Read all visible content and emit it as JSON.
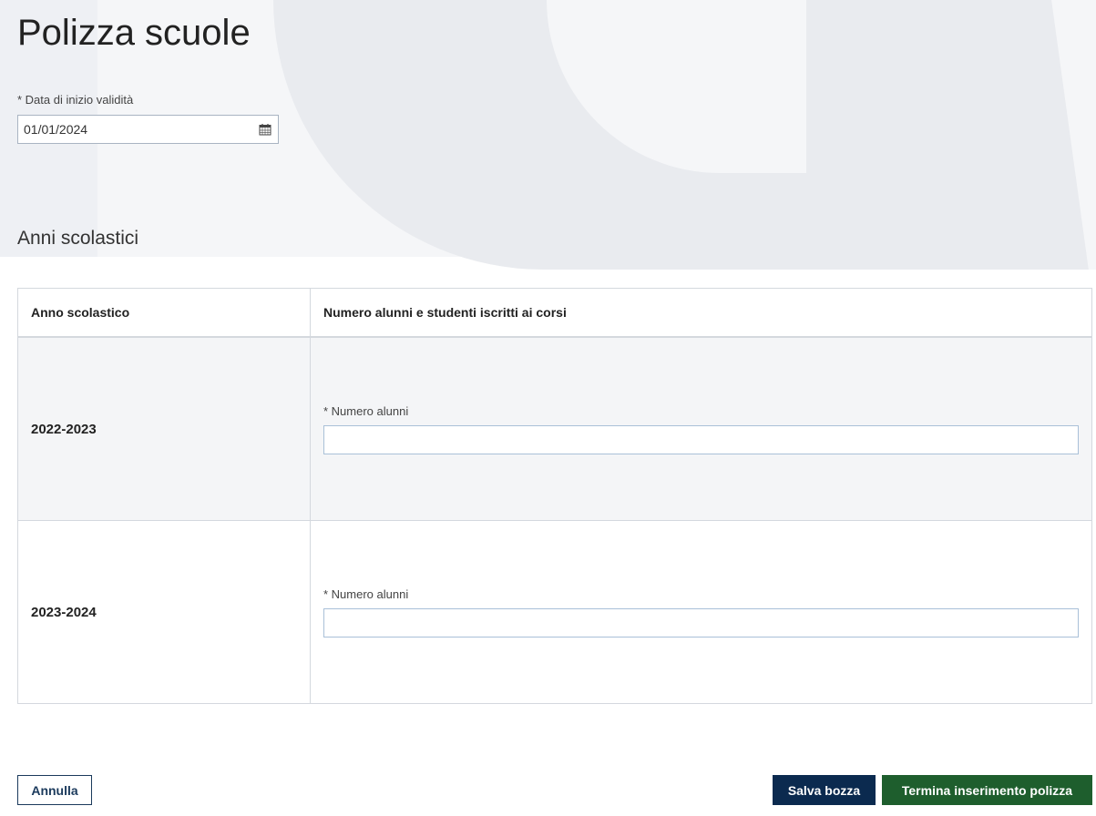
{
  "page": {
    "title": "Polizza scuole"
  },
  "validity": {
    "label": "* Data di inizio validità",
    "value": "01/01/2024",
    "icon": "calendar-icon"
  },
  "section": {
    "title": "Anni scolastici"
  },
  "table": {
    "headers": [
      "Anno scolastico",
      "Numero alunni e studenti iscritti ai corsi"
    ],
    "rows": [
      {
        "year": "2022-2023",
        "field_label": "* Numero alunni",
        "value": ""
      },
      {
        "year": "2023-2024",
        "field_label": "* Numero alunni",
        "value": ""
      }
    ]
  },
  "actions": {
    "cancel_label": "Annulla",
    "draft_label": "Salva bozza",
    "finish_label": "Termina inserimento polizza"
  },
  "colors": {
    "draft_button": "#0b2a4f",
    "finish_button": "#1e5e2d",
    "cancel_border": "#1b3a5c"
  }
}
